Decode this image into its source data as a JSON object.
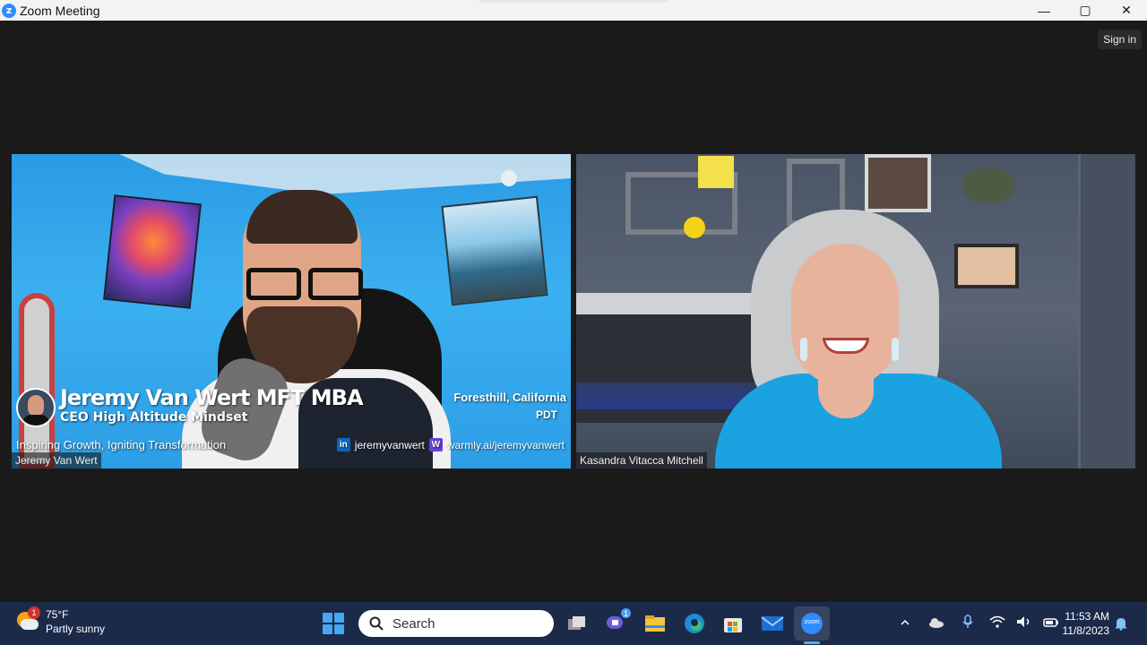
{
  "window": {
    "title": "Zoom Meeting",
    "controls": {
      "minimize": "—",
      "maximize": "▢",
      "close": "✕"
    }
  },
  "meeting": {
    "sign_in_label": "Sign in",
    "participants": [
      {
        "name_tag": "Jeremy Van Wert",
        "overlay": {
          "display_name": "Jeremy Van Wert MFT MBA",
          "title": "CEO High Altitude Mindset",
          "tagline": "Inspiring Growth, Igniting Transformation",
          "location": "Foresthill, California",
          "timezone": "PDT",
          "linkedin": "jeremyvanwert",
          "website": "warmly.ai/jeremyvanwert"
        }
      },
      {
        "name_tag": "Kasandra Vitacca Mitchell"
      }
    ]
  },
  "taskbar": {
    "weather": {
      "badge": "1",
      "temperature": "75°F",
      "condition": "Partly sunny"
    },
    "search_placeholder": "Search",
    "chat_badge": "1",
    "zoom_label": "zoom",
    "clock": {
      "time": "11:53 AM",
      "date": "11/8/2023"
    }
  },
  "icons": [
    "zoom-logo-icon",
    "minimize-icon",
    "maximize-icon",
    "close-icon",
    "windows-start-icon",
    "search-icon",
    "task-view-icon",
    "chat-icon",
    "file-explorer-icon",
    "edge-icon",
    "store-icon",
    "mail-icon",
    "zoom-icon",
    "chevron-up-icon",
    "onedrive-icon",
    "microphone-icon",
    "wifi-icon",
    "volume-icon",
    "battery-icon",
    "notification-bell-icon",
    "linkedin-icon",
    "warmly-icon"
  ],
  "colors": {
    "accent": "#2d8cff",
    "taskbar": "#1c2a4a",
    "meeting_bg": "#1a1a1a"
  }
}
